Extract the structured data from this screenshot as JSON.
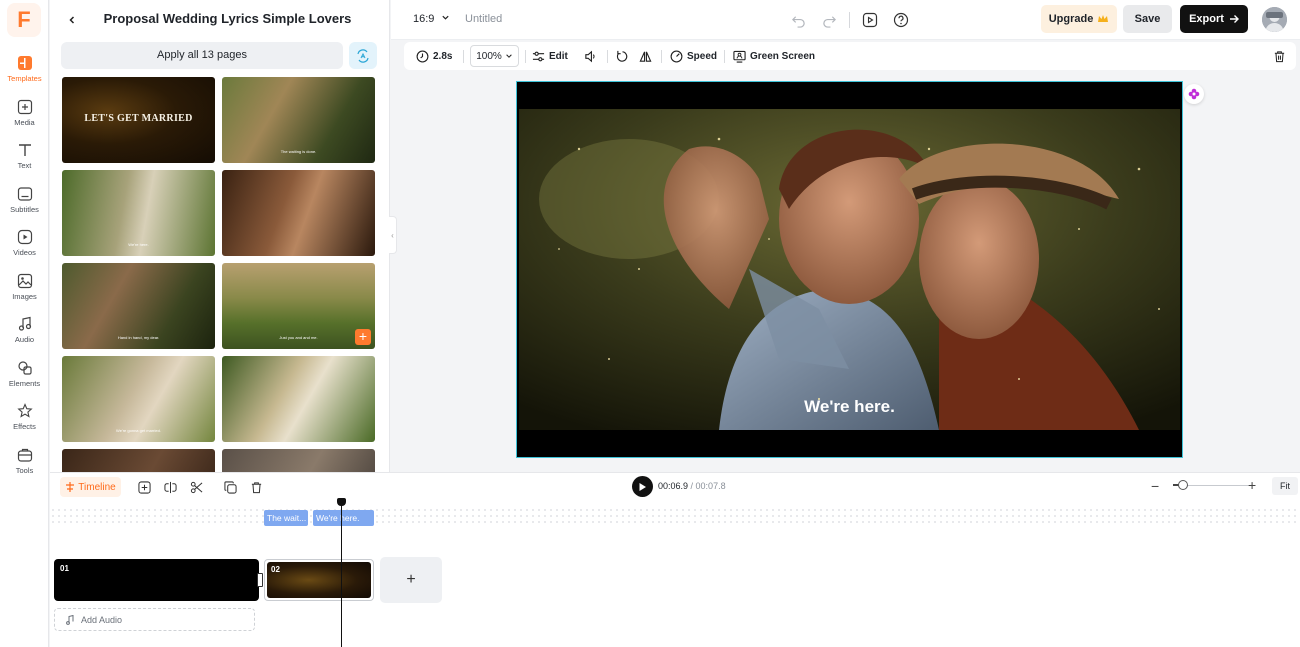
{
  "app": {
    "logo_letter": "F",
    "brand_color": "#ff7a2e",
    "accent_color": "#3ec3d8"
  },
  "rail": {
    "items": [
      {
        "label": "Templates",
        "icon": "templates-icon",
        "active": true
      },
      {
        "label": "Media",
        "icon": "media-icon"
      },
      {
        "label": "Text",
        "icon": "text-icon"
      },
      {
        "label": "Subtitles",
        "icon": "subtitles-icon"
      },
      {
        "label": "Videos",
        "icon": "videos-icon"
      },
      {
        "label": "Images",
        "icon": "images-icon"
      },
      {
        "label": "Audio",
        "icon": "audio-icon"
      },
      {
        "label": "Elements",
        "icon": "elements-icon"
      },
      {
        "label": "Effects",
        "icon": "effects-icon"
      },
      {
        "label": "Tools",
        "icon": "tools-icon"
      }
    ]
  },
  "panel": {
    "title": "Proposal Wedding Lyrics Simple Lovers",
    "apply_all_label": "Apply all 13 pages",
    "thumbnails": [
      {
        "caption": "LET'S GET MARRIED",
        "style": "title"
      },
      {
        "caption": "The waiting is done."
      },
      {
        "caption": "We're here."
      },
      {
        "caption": ""
      },
      {
        "caption": "Hand in hand, my dear."
      },
      {
        "caption": "Just you and and me."
      },
      {
        "caption": "We're gonna get married."
      },
      {
        "caption": ""
      },
      {
        "caption": ""
      },
      {
        "caption": ""
      }
    ]
  },
  "topbar": {
    "aspect_ratio": "16:9",
    "project_name": "Untitled",
    "upgrade_label": "Upgrade",
    "save_label": "Save",
    "export_label": "Export"
  },
  "toolbar": {
    "duration": "2.8s",
    "zoom": "100%",
    "edit_label": "Edit",
    "speed_label": "Speed",
    "green_screen_label": "Green Screen"
  },
  "canvas": {
    "caption": "We're here."
  },
  "timeline": {
    "tab_label": "Timeline",
    "current_time": "00:06.9",
    "separator": " / ",
    "total_time": "00:07.8",
    "fit_label": "Fit",
    "subtitles": [
      "The wait...",
      "We're here."
    ],
    "clips": [
      {
        "number": "01"
      },
      {
        "number": "02"
      }
    ],
    "add_audio_label": "Add Audio"
  }
}
